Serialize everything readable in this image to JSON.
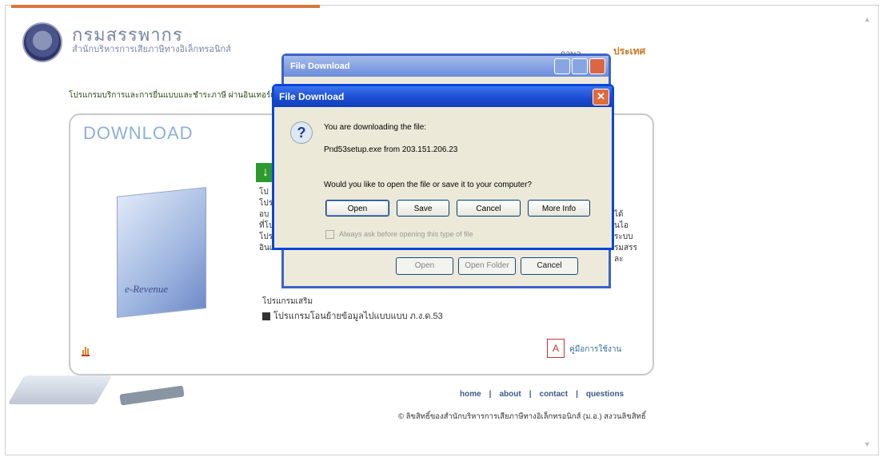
{
  "header": {
    "org_title": "กรมสรรพากร",
    "org_subtitle": "สำนักบริหารการเสียภาษีทางอิเล็กทรอนิกส์",
    "top_link_left": "ภาษา",
    "top_link_right": "ประเทศ"
  },
  "marquee_text": "โปรแกรมบริการและการยื่นแบบและชำระภาษี ผ่านอินเทอร์เน็ต",
  "panel": {
    "title": "DOWNLOAD",
    "product_label": "e-Revenue",
    "intro_lines": [
      "โป",
      "โปร",
      "อบ",
      "ที่โป",
      "โปรแ",
      "อินเท"
    ],
    "right_lines": [
      "ได้",
      "นไอ",
      "ระบบ",
      "รมสรร",
      "ละ"
    ],
    "doc_heading": "โปรแกรมเสริม",
    "doc_link": "โปรแกรมโอนย้ายข้อมูลไปแบบแบบ ภ.ง.ด.53",
    "manual_link": "คู่มือการใช้งาน"
  },
  "footer": {
    "links": [
      "home",
      "about",
      "contact",
      "questions"
    ],
    "separator": "|",
    "copyright": "© ลิขสิทธิ์ของสำนักบริหารการเสียภาษีทางอิเล็กทรอนิกส์ (ม.อ.) สงวนลิขสิทธิ์"
  },
  "dialog_back": {
    "title": "File Download",
    "buttons": [
      "Open",
      "Open Folder",
      "Cancel"
    ]
  },
  "dialog": {
    "title": "File Download",
    "message": "You are downloading the file:",
    "file_line": "Pnd53setup.exe from 203.151.206.23",
    "question": "Would you like to open the file or save it to your computer?",
    "open_label": "Open",
    "save_label": "Save",
    "cancel_label": "Cancel",
    "more_info_label": "More Info",
    "checkbox_label": "Always ask before opening this type of file",
    "close_glyph": "✕",
    "icon": "question-icon"
  }
}
